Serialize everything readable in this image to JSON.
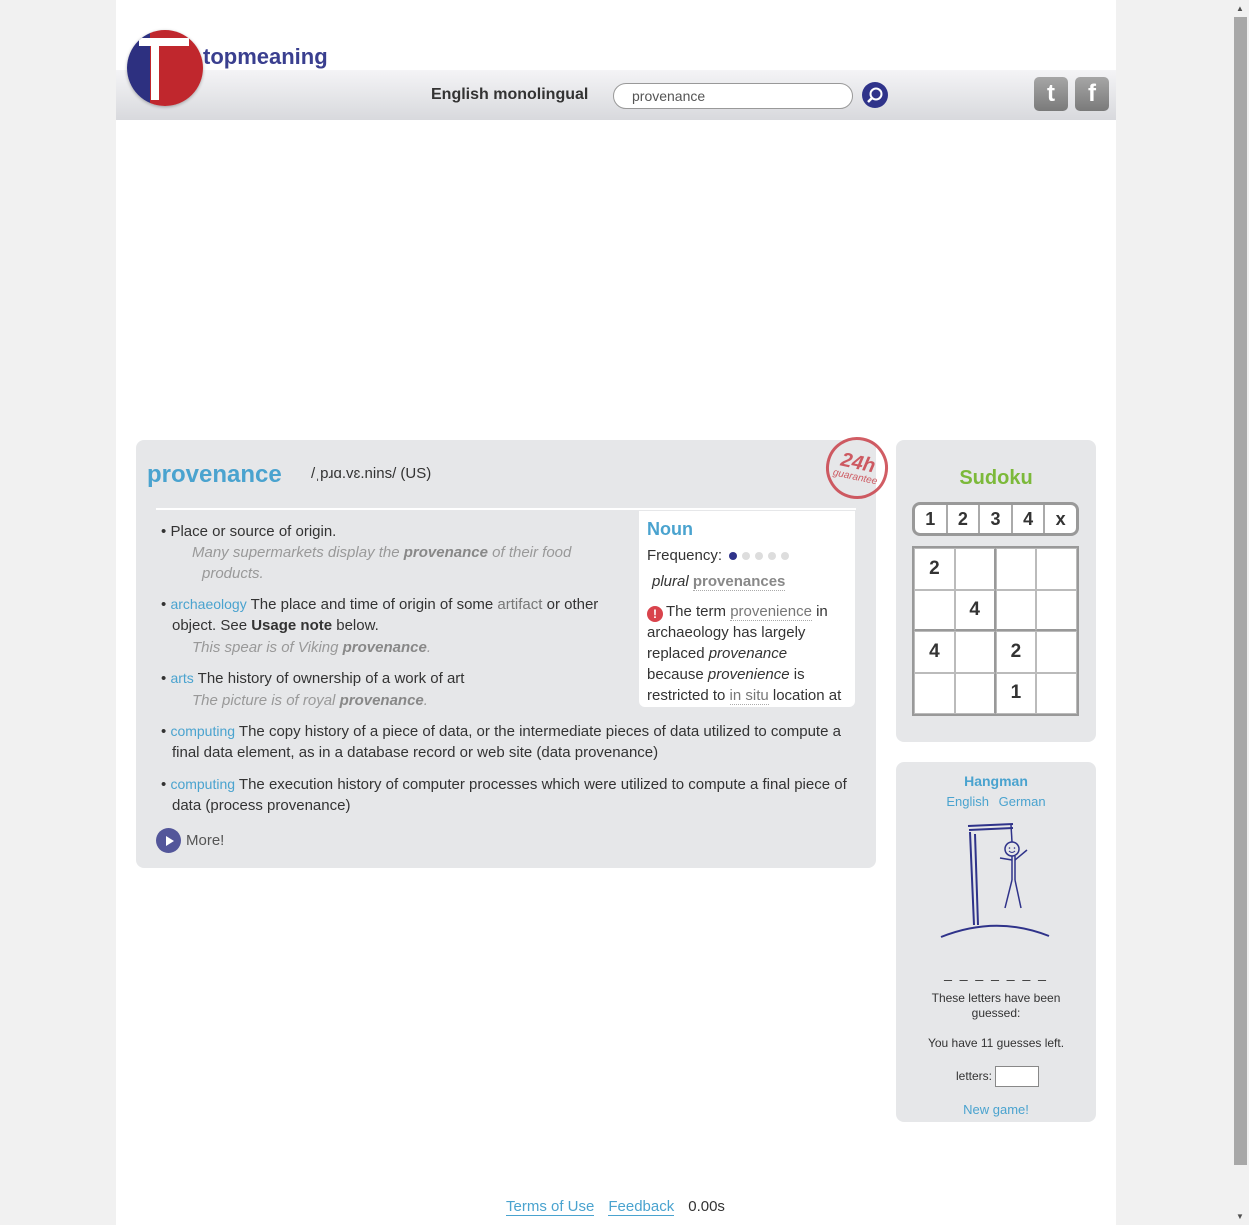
{
  "header": {
    "brand": "topmeaning",
    "language_label": "English monolingual",
    "search_value": "provenance",
    "twitter_glyph": "t",
    "facebook_glyph": "f"
  },
  "entry": {
    "word": "provenance",
    "pronunciation": "/ˌpɹɑ.vɛ.nins/ (US)",
    "stamp_big": "24h",
    "stamp_small": "guarantee",
    "senses": [
      {
        "bullet": "•",
        "domain": "",
        "text": "Place or source of origin.",
        "example_pre": "Many supermarkets display the ",
        "example_bold": "provenance",
        "example_post": " of their food",
        "example_line2": "products."
      },
      {
        "bullet": "•",
        "domain": "archaeology",
        "text_pre": " The place and time of origin of some ",
        "link": "artifact",
        "text_post": " or other",
        "line2_pre": "object. See ",
        "line2_bold": "Usage note",
        "line2_post": " below.",
        "example_pre": "This spear is of Viking ",
        "example_bold": "provenance",
        "example_post": "."
      },
      {
        "bullet": "•",
        "domain": "arts",
        "text": " The history of ownership of a work of art",
        "example_pre": "The picture is of royal ",
        "example_bold": "provenance",
        "example_post": "."
      },
      {
        "bullet": "•",
        "domain": "computing",
        "text": " The copy history of a piece of data, or the intermediate pieces of data utilized to compute a",
        "line2": "final data element, as in a database record or web site (data provenance)"
      },
      {
        "bullet": "•",
        "domain": "computing",
        "text": " The execution history of computer processes which were utilized to compute a final piece of",
        "line2": "data (process provenance)"
      }
    ],
    "more_label": "More!"
  },
  "info": {
    "pos": "Noun",
    "frequency_label": "Frequency:",
    "frequency_level": 1,
    "frequency_max": 5,
    "plural_label": "plural",
    "plural_word": "provenances",
    "warn_glyph": "!",
    "note_pre": "The term ",
    "note_link1": "provenience",
    "note_mid1": " in archaeology has largely replaced ",
    "note_it1": "provenance",
    "note_mid2": " because ",
    "note_it2": "provenience",
    "note_mid3": " is restricted to ",
    "note_link2": "in situ",
    "note_post": " location at"
  },
  "sudoku": {
    "title": "Sudoku",
    "buttons": [
      "1",
      "2",
      "3",
      "4",
      "x"
    ],
    "cells": [
      "2",
      "",
      "",
      "",
      "",
      "4",
      "",
      "",
      "4",
      "",
      "2",
      "",
      "",
      "",
      "1",
      ""
    ]
  },
  "hangman": {
    "title": "Hangman",
    "languages": [
      "English",
      "German"
    ],
    "blanks": "_ _ _ _ _ _ _",
    "guessed_label": "These letters have been guessed:",
    "guesses_left": "You have 11 guesses left.",
    "letters_label": "letters:",
    "new_game": "New game!"
  },
  "footer": {
    "terms": "Terms of Use",
    "feedback": "Feedback",
    "time": "0.00s"
  },
  "colors": {
    "accent": "#4aa3cf",
    "brand": "#3a3f8f",
    "sudoku_title": "#7cb93a",
    "warning": "#d9434c"
  }
}
